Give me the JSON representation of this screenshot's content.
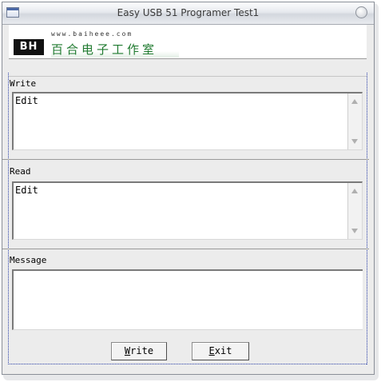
{
  "window": {
    "title": "Easy USB 51 Programer Test1"
  },
  "banner": {
    "logo_text": "BH",
    "site": "www.baiheee.com",
    "company_cn": "百合电子工作室"
  },
  "write_section": {
    "label": "Write",
    "text": "Edit"
  },
  "read_section": {
    "label": "Read",
    "text": "Edit"
  },
  "message_section": {
    "label": "Message",
    "text": ""
  },
  "buttons": {
    "write": {
      "mnemonic": "W",
      "rest": "rite"
    },
    "exit": {
      "mnemonic": "E",
      "rest": "xit"
    }
  },
  "icons": [
    "window-icon",
    "window-control-icon",
    "scroll-up-icon",
    "scroll-down-icon"
  ]
}
